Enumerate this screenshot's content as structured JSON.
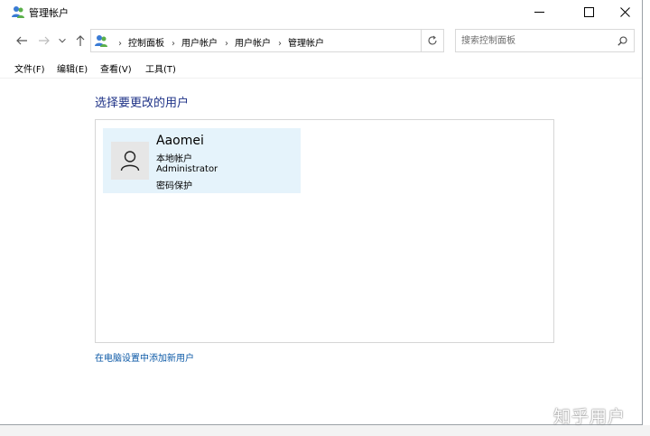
{
  "window": {
    "title": "管理帐户"
  },
  "navigation": {
    "breadcrumbs": [
      "控制面板",
      "用户帐户",
      "用户帐户",
      "管理帐户"
    ],
    "search_placeholder": "搜索控制面板"
  },
  "menu": {
    "items": [
      "文件(F)",
      "编辑(E)",
      "查看(V)",
      "工具(T)"
    ]
  },
  "main": {
    "heading": "选择要更改的用户",
    "user": {
      "name": "Aaomei",
      "type": "本地帐户",
      "role": "Administrator",
      "status": "密码保护"
    },
    "add_user_link": "在电脑设置中添加新用户"
  },
  "watermark": "知乎用户",
  "colors": {
    "heading": "#1e3287",
    "link": "#0d5aa7",
    "tile_bg": "#e5f3fb"
  },
  "icons": [
    "users-icon",
    "minimize-icon",
    "maximize-icon",
    "close-icon",
    "back-arrow-icon",
    "forward-arrow-icon",
    "recent-dropdown-icon",
    "up-arrow-icon",
    "refresh-icon",
    "search-icon",
    "user-avatar-icon"
  ]
}
